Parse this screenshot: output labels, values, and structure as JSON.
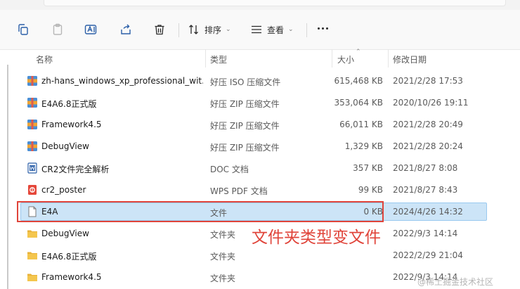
{
  "toolbar": {
    "sort_label": "排序",
    "view_label": "查看"
  },
  "columns": {
    "name": "名称",
    "type": "类型",
    "size": "大小",
    "modified": "修改日期"
  },
  "files": [
    {
      "name": "zh-hans_windows_xp_professional_wit...",
      "type": "好压 ISO 压缩文件",
      "size": "615,468 KB",
      "modified": "2021/2/28 17:53",
      "icon": "archive-icon"
    },
    {
      "name": "E4A6.8正式版",
      "type": "好压 ZIP 压缩文件",
      "size": "353,064 KB",
      "modified": "2020/10/26 19:11",
      "icon": "archive-icon"
    },
    {
      "name": "Framework4.5",
      "type": "好压 ZIP 压缩文件",
      "size": "66,011 KB",
      "modified": "2021/2/28 20:49",
      "icon": "archive-icon"
    },
    {
      "name": "DebugView",
      "type": "好压 ZIP 压缩文件",
      "size": "1,329 KB",
      "modified": "2021/2/28 20:24",
      "icon": "archive-icon"
    },
    {
      "name": "CR2文件完全解析",
      "type": "DOC 文档",
      "size": "357 KB",
      "modified": "2021/8/27 8:08",
      "icon": "word-doc-icon"
    },
    {
      "name": "cr2_poster",
      "type": "WPS PDF 文档",
      "size": "99 KB",
      "modified": "2021/8/27 8:43",
      "icon": "pdf-icon"
    },
    {
      "name": "E4A",
      "type": "文件",
      "size": "0 KB",
      "modified": "2024/4/26 14:32",
      "icon": "blank-file-icon",
      "selected": true
    },
    {
      "name": "DebugView",
      "type": "文件夹",
      "size": "",
      "modified": "2022/9/3 14:14",
      "icon": "folder-icon"
    },
    {
      "name": "E4A6.8正式版",
      "type": "文件夹",
      "size": "",
      "modified": "2022/2/29 21:04",
      "icon": "folder-icon"
    },
    {
      "name": "Framework4.5",
      "type": "文件夹",
      "size": "",
      "modified": "2022/9/3 14:14",
      "icon": "folder-icon"
    }
  ],
  "annotation": "文件夹类型变文件",
  "watermark": "@稀土掘金技术社区",
  "colors": {
    "selection": "#cce4f7",
    "annotation": "#e0443a",
    "folder": "#f4c64e"
  }
}
